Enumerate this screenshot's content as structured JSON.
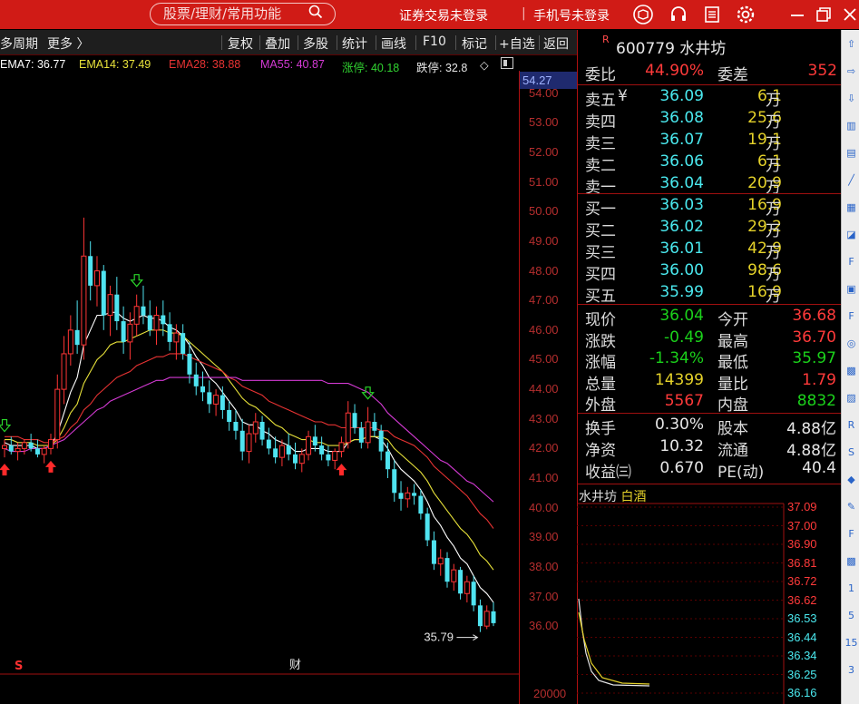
{
  "titlebar": {
    "search_placeholder": "股票/理财/常用功能",
    "login_securities": "证券交易未登录",
    "login_phone": "手机号未登录",
    "icons": [
      "app-logo-icon",
      "headset-icon",
      "news-icon",
      "gear-icon",
      "minimize-icon",
      "restore-icon",
      "close-icon"
    ]
  },
  "toolbar": {
    "left": [
      "多周期",
      "更多 〉"
    ],
    "buttons": [
      "复权",
      "叠加",
      "多股",
      "统计",
      "画线",
      "F10",
      "标记",
      "+自选",
      "返回"
    ]
  },
  "legend": {
    "ema7": "EMA7: 36.77",
    "ema14": "EMA14: 37.49",
    "ema28": "EMA28: 38.88",
    "ma55": "MA55: 40.87",
    "limit_up": "涨停: 40.18",
    "limit_down": "跌停: 32.8",
    "colors": {
      "ema7": "#ffffff",
      "ema14": "#e8e23a",
      "ema28": "#e83333",
      "ma55": "#d43ad4",
      "limit_up": "#31d431",
      "limit_down": "#e6e6e6"
    }
  },
  "axis": {
    "current_price_tag": "54.27",
    "labels": [
      "54.00",
      "53.00",
      "52.00",
      "51.00",
      "50.00",
      "49.00",
      "48.00",
      "47.00",
      "46.00",
      "45.00",
      "44.00",
      "43.00",
      "42.00",
      "41.00",
      "40.00",
      "39.00",
      "38.00",
      "37.00",
      "36.00"
    ],
    "volume_label": "20000"
  },
  "chart_data": {
    "type": "candlestick",
    "ylim": [
      35.3,
      54.3
    ],
    "min_annotation": "35.79",
    "markers": {
      "s": "S",
      "cai": "财"
    },
    "candles": [
      [
        42.0,
        42.3,
        41.7,
        42.1
      ],
      [
        42.1,
        42.4,
        41.8,
        41.9
      ],
      [
        41.9,
        42.2,
        41.6,
        42.0
      ],
      [
        42.0,
        42.3,
        41.8,
        42.2
      ],
      [
        42.2,
        42.5,
        41.9,
        42.0
      ],
      [
        42.0,
        42.3,
        41.7,
        41.8
      ],
      [
        41.8,
        42.1,
        41.5,
        42.0
      ],
      [
        42.0,
        42.5,
        41.8,
        42.3
      ],
      [
        42.3,
        44.5,
        42.0,
        44.0
      ],
      [
        44.0,
        45.8,
        43.5,
        45.2
      ],
      [
        45.2,
        46.5,
        44.8,
        46.0
      ],
      [
        46.0,
        47.0,
        45.2,
        45.5
      ],
      [
        45.5,
        49.8,
        45.0,
        48.5
      ],
      [
        48.5,
        49.0,
        47.0,
        47.5
      ],
      [
        47.5,
        48.5,
        46.8,
        48.0
      ],
      [
        48.0,
        48.2,
        46.0,
        46.5
      ],
      [
        46.5,
        47.5,
        45.8,
        47.2
      ],
      [
        47.2,
        47.8,
        46.0,
        46.3
      ],
      [
        46.3,
        46.8,
        45.2,
        45.6
      ],
      [
        45.6,
        46.6,
        45.0,
        46.2
      ],
      [
        46.2,
        47.2,
        45.8,
        46.8
      ],
      [
        46.8,
        47.5,
        46.2,
        46.5
      ],
      [
        46.5,
        47.0,
        45.8,
        46.0
      ],
      [
        46.0,
        46.8,
        45.5,
        46.5
      ],
      [
        46.5,
        47.0,
        45.8,
        46.2
      ],
      [
        46.2,
        46.6,
        45.3,
        45.6
      ],
      [
        45.6,
        46.2,
        45.0,
        45.9
      ],
      [
        45.9,
        46.2,
        45.0,
        45.2
      ],
      [
        45.2,
        45.6,
        44.2,
        44.5
      ],
      [
        44.5,
        44.9,
        43.8,
        44.1
      ],
      [
        44.1,
        44.6,
        43.6,
        43.9
      ],
      [
        43.9,
        44.3,
        43.2,
        43.5
      ],
      [
        43.5,
        44.0,
        43.1,
        43.8
      ],
      [
        43.8,
        44.1,
        43.0,
        43.3
      ],
      [
        43.3,
        43.6,
        42.6,
        42.9
      ],
      [
        42.9,
        43.3,
        42.3,
        42.6
      ],
      [
        42.6,
        43.0,
        41.6,
        41.9
      ],
      [
        41.9,
        42.8,
        41.5,
        42.5
      ],
      [
        42.5,
        43.2,
        42.2,
        42.9
      ],
      [
        42.9,
        43.1,
        42.1,
        42.3
      ],
      [
        42.3,
        42.7,
        41.8,
        42.0
      ],
      [
        42.0,
        42.4,
        41.5,
        41.7
      ],
      [
        41.7,
        42.3,
        41.4,
        42.1
      ],
      [
        42.1,
        42.5,
        41.6,
        41.8
      ],
      [
        41.8,
        42.2,
        41.3,
        41.5
      ],
      [
        41.5,
        42.0,
        41.2,
        41.8
      ],
      [
        41.8,
        42.6,
        41.6,
        42.4
      ],
      [
        42.4,
        42.8,
        41.9,
        42.1
      ],
      [
        42.1,
        42.4,
        41.6,
        41.8
      ],
      [
        41.8,
        42.1,
        41.4,
        41.6
      ],
      [
        41.6,
        42.0,
        41.3,
        41.9
      ],
      [
        41.9,
        42.4,
        41.7,
        42.2
      ],
      [
        42.2,
        43.6,
        42.0,
        43.2
      ],
      [
        43.2,
        43.5,
        42.5,
        42.7
      ],
      [
        42.7,
        42.9,
        42.0,
        42.2
      ],
      [
        42.2,
        43.4,
        42.0,
        42.9
      ],
      [
        42.9,
        43.2,
        42.4,
        42.6
      ],
      [
        42.6,
        42.8,
        41.6,
        41.9
      ],
      [
        41.9,
        42.2,
        41.0,
        41.3
      ],
      [
        41.3,
        41.6,
        40.2,
        40.5
      ],
      [
        40.5,
        40.9,
        39.9,
        40.3
      ],
      [
        40.3,
        40.7,
        40.0,
        40.5
      ],
      [
        40.5,
        40.8,
        40.1,
        40.4
      ],
      [
        40.4,
        40.6,
        39.6,
        39.8
      ],
      [
        39.8,
        40.0,
        38.7,
        38.9
      ],
      [
        38.9,
        39.2,
        37.9,
        38.1
      ],
      [
        38.1,
        38.6,
        37.7,
        38.3
      ],
      [
        38.3,
        38.5,
        37.3,
        37.5
      ],
      [
        37.5,
        38.1,
        37.2,
        37.9
      ],
      [
        37.9,
        38.0,
        36.9,
        37.1
      ],
      [
        37.1,
        37.7,
        36.8,
        37.5
      ],
      [
        37.5,
        37.7,
        36.5,
        36.7
      ],
      [
        36.7,
        36.9,
        35.8,
        36.0
      ],
      [
        36.0,
        36.7,
        35.9,
        36.5
      ],
      [
        36.5,
        36.8,
        36.0,
        36.1
      ]
    ],
    "lines": {
      "ema7": [
        42.2,
        42.1,
        42.1,
        42.1,
        42.1,
        42.0,
        42.0,
        42.1,
        42.5,
        43.2,
        43.9,
        44.4,
        45.5,
        46.0,
        46.5,
        46.5,
        46.6,
        46.6,
        46.4,
        46.3,
        46.4,
        46.5,
        46.4,
        46.4,
        46.3,
        46.1,
        46.0,
        45.8,
        45.5,
        45.1,
        44.8,
        44.4,
        44.2,
        43.9,
        43.6,
        43.3,
        42.9,
        42.8,
        42.8,
        42.6,
        42.5,
        42.3,
        42.2,
        42.1,
        41.9,
        41.9,
        42.0,
        42.0,
        42.0,
        41.9,
        41.9,
        41.9,
        42.2,
        42.3,
        42.3,
        42.4,
        42.4,
        42.3,
        42.0,
        41.6,
        41.3,
        41.1,
        40.9,
        40.6,
        40.2,
        39.7,
        39.4,
        39.0,
        38.7,
        38.3,
        38.1,
        37.7,
        37.3,
        37.1,
        36.8
      ],
      "ema14": [
        42.3,
        42.3,
        42.2,
        42.2,
        42.2,
        42.1,
        42.1,
        42.1,
        42.3,
        42.7,
        43.2,
        43.5,
        44.2,
        44.6,
        45.0,
        45.2,
        45.5,
        45.6,
        45.6,
        45.7,
        45.8,
        45.9,
        46.0,
        46.0,
        46.0,
        45.9,
        45.9,
        45.8,
        45.6,
        45.4,
        45.2,
        45.0,
        44.8,
        44.6,
        44.3,
        44.0,
        43.7,
        43.5,
        43.4,
        43.2,
        43.0,
        42.8,
        42.7,
        42.5,
        42.4,
        42.3,
        42.3,
        42.2,
        42.2,
        42.1,
        42.1,
        42.1,
        42.2,
        42.3,
        42.3,
        42.4,
        42.4,
        42.4,
        42.3,
        42.0,
        41.8,
        41.6,
        41.4,
        41.2,
        40.9,
        40.5,
        40.2,
        39.9,
        39.6,
        39.3,
        39.1,
        38.8,
        38.4,
        38.2,
        37.9
      ],
      "ema28": [
        42.4,
        42.4,
        42.4,
        42.3,
        42.3,
        42.3,
        42.2,
        42.2,
        42.3,
        42.4,
        42.7,
        42.9,
        43.3,
        43.5,
        43.8,
        44.0,
        44.2,
        44.4,
        44.5,
        44.6,
        44.8,
        44.9,
        45.0,
        45.1,
        45.1,
        45.2,
        45.2,
        45.2,
        45.1,
        45.0,
        44.9,
        44.8,
        44.7,
        44.6,
        44.4,
        44.3,
        44.1,
        44.0,
        43.9,
        43.8,
        43.6,
        43.5,
        43.4,
        43.3,
        43.2,
        43.1,
        43.0,
        42.9,
        42.9,
        42.8,
        42.8,
        42.7,
        42.7,
        42.7,
        42.7,
        42.7,
        42.7,
        42.6,
        42.6,
        42.4,
        42.3,
        42.2,
        42.1,
        41.9,
        41.7,
        41.4,
        41.2,
        41.0,
        40.8,
        40.6,
        40.4,
        40.1,
        39.8,
        39.6,
        39.3
      ],
      "ma55": [
        42.0,
        41.9,
        41.9,
        41.9,
        42.0,
        42.0,
        42.0,
        42.1,
        42.2,
        42.3,
        42.5,
        42.7,
        42.9,
        43.1,
        43.3,
        43.4,
        43.6,
        43.7,
        43.8,
        43.9,
        44.0,
        44.1,
        44.2,
        44.3,
        44.3,
        44.4,
        44.4,
        44.4,
        44.4,
        44.4,
        44.4,
        44.4,
        44.4,
        44.4,
        44.4,
        44.4,
        44.3,
        44.3,
        44.3,
        44.3,
        44.3,
        44.3,
        44.3,
        44.3,
        44.3,
        44.3,
        44.3,
        44.3,
        44.3,
        44.2,
        44.2,
        44.2,
        44.2,
        44.1,
        44.0,
        43.9,
        43.7,
        43.5,
        43.2,
        43.0,
        42.8,
        42.6,
        42.4,
        42.2,
        42.0,
        41.8,
        41.6,
        41.5,
        41.3,
        41.1,
        40.9,
        40.8,
        40.6,
        40.4,
        40.2
      ]
    }
  },
  "quote": {
    "code_name": "600779 水井坊",
    "r_mark": "R",
    "weibi_label": "委比",
    "weibi": "44.90%",
    "weicha_label": "委差",
    "weicha": "352",
    "sells": [
      {
        "label": "卖五",
        "yen": "¥",
        "price": "36.09",
        "vol": "6.1",
        "unit": "万"
      },
      {
        "label": "卖四",
        "yen": "",
        "price": "36.08",
        "vol": "25.6",
        "unit": "万"
      },
      {
        "label": "卖三",
        "yen": "",
        "price": "36.07",
        "vol": "19.1",
        "unit": "万"
      },
      {
        "label": "卖二",
        "yen": "",
        "price": "36.06",
        "vol": "6.1",
        "unit": "万"
      },
      {
        "label": "卖一",
        "yen": "",
        "price": "36.04",
        "vol": "20.9",
        "unit": "万"
      }
    ],
    "buys": [
      {
        "label": "买一",
        "price": "36.03",
        "vol": "16.9",
        "unit": "万"
      },
      {
        "label": "买二",
        "price": "36.02",
        "vol": "29.2",
        "unit": "万"
      },
      {
        "label": "买三",
        "price": "36.01",
        "vol": "42.9",
        "unit": "万"
      },
      {
        "label": "买四",
        "price": "36.00",
        "vol": "98.6",
        "unit": "万"
      },
      {
        "label": "买五",
        "price": "35.99",
        "vol": "16.9",
        "unit": "万"
      }
    ],
    "stats": [
      [
        {
          "l": "现价",
          "v": "36.04",
          "c": "green"
        },
        {
          "l": "今开",
          "v": "36.68",
          "c": "red"
        }
      ],
      [
        {
          "l": "涨跌",
          "v": "-0.49",
          "c": "green"
        },
        {
          "l": "最高",
          "v": "36.70",
          "c": "red"
        }
      ],
      [
        {
          "l": "涨幅",
          "v": "-1.34%",
          "c": "green"
        },
        {
          "l": "最低",
          "v": "35.97",
          "c": "green"
        }
      ],
      [
        {
          "l": "总量",
          "v": "14399",
          "c": "yellow"
        },
        {
          "l": "量比",
          "v": "1.79",
          "c": "red"
        }
      ],
      [
        {
          "l": "外盘",
          "v": "5567",
          "c": "red"
        },
        {
          "l": "内盘",
          "v": "8832",
          "c": "green"
        }
      ]
    ],
    "fund": [
      [
        {
          "l": "换手",
          "v": "0.30%"
        },
        {
          "l": "股本",
          "v": "4.88亿"
        }
      ],
      [
        {
          "l": "净资",
          "v": "10.32"
        },
        {
          "l": "流通",
          "v": "4.88亿"
        }
      ],
      [
        {
          "l": "收益㈢",
          "v": "0.670"
        },
        {
          "l": "PE(动)",
          "v": "40.4"
        }
      ]
    ]
  },
  "minichart": {
    "title": "水井坊",
    "sector": "白酒",
    "labels": [
      "37.09",
      "37.00",
      "36.90",
      "36.81",
      "36.72",
      "36.62",
      "36.53",
      "36.44",
      "36.34",
      "36.25",
      "36.16"
    ]
  },
  "right_sidebar": {
    "icons": [
      "scroll-up-icon",
      "scroll-right-icon",
      "scroll-down-icon",
      "tool-book-icon",
      "tool-bars-icon",
      "tool-line-icon",
      "tool-grid-icon",
      "tool-fund-icon",
      "tool-fi-icon",
      "tool-box-icon",
      "tool-fi2-icon",
      "tool-globe-icon",
      "tool-stripe-icon",
      "tool-chart-icon",
      "tool-rs-icon",
      "tool-s-icon",
      "tool-diamond-icon",
      "tool-pen-icon",
      "tool-fs-icon",
      "tool-green-icon",
      "tool-1-icon",
      "tool-5-icon",
      "tool-15-icon",
      "tool-3-icon"
    ],
    "texts": [
      "Fi",
      "Fi",
      "RS",
      "Fs",
      "1",
      "5",
      "15",
      "3"
    ]
  }
}
